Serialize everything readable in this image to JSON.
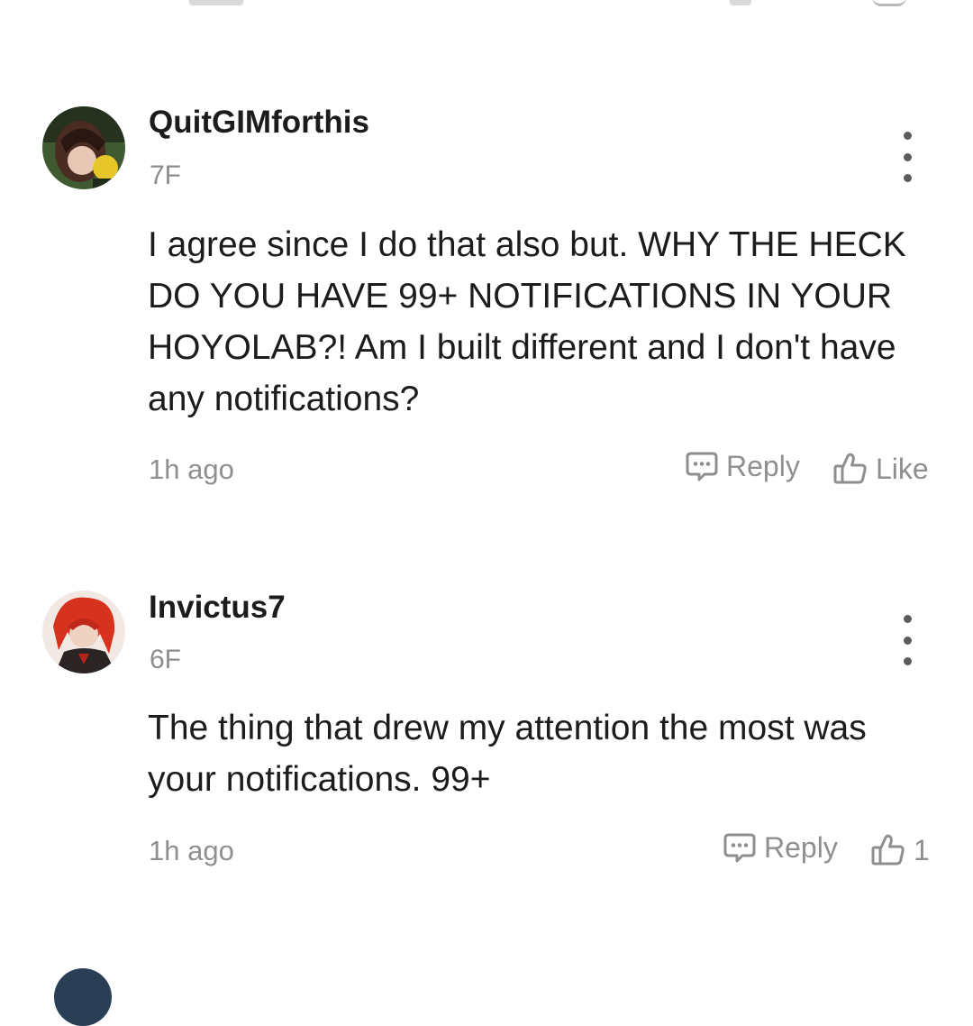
{
  "comments": [
    {
      "username": "QuitGIMforthis",
      "floor": "7F",
      "text": "I agree since I do that also but. WHY THE HECK DO YOU HAVE 99+ NOTIFICATIONS IN YOUR HOYOLAB?! Am I built different and I don't have any notifications?",
      "time": "1h ago",
      "reply_label": "Reply",
      "like_label": "Like",
      "more_icon": "more-vertical-icon",
      "avatar_colors": [
        "#2f4a24",
        "#5b3a2a",
        "#e6c628"
      ]
    },
    {
      "username": "Invictus7",
      "floor": "6F",
      "text": "The thing that drew my attention the most was your notifications. 99+",
      "time": "1h ago",
      "reply_label": "Reply",
      "like_count": "1",
      "more_icon": "more-vertical-icon",
      "avatar_colors": [
        "#d7321e",
        "#2b2424",
        "#f2e9e4"
      ]
    }
  ],
  "icons": {
    "reply": "comment-bubble-icon",
    "like": "thumbs-up-icon",
    "more": "more-vertical-icon"
  },
  "colors": {
    "text": "#1c1c1c",
    "muted": "#8f8f8f",
    "background": "#ffffff"
  }
}
